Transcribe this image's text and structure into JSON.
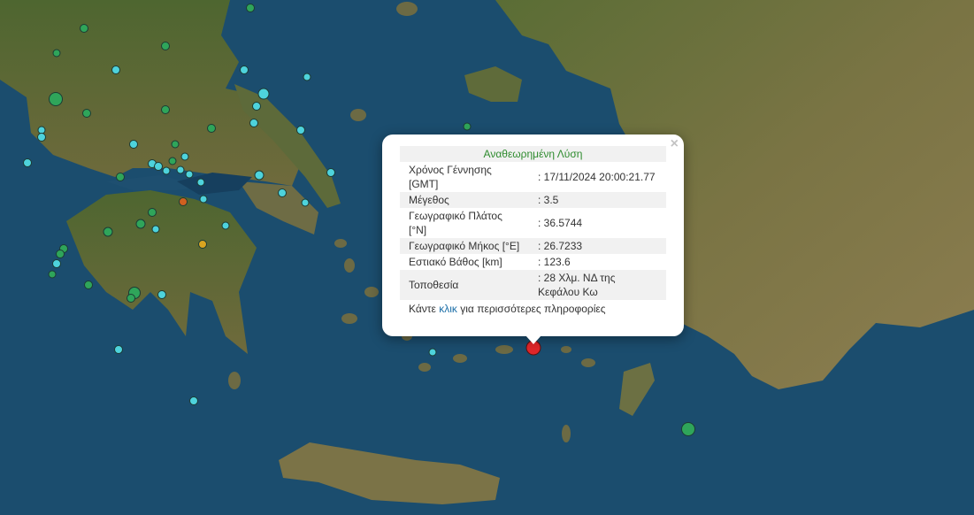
{
  "map": {
    "colors": {
      "sea": "#1b4d6e",
      "land_green": "#4f6a33",
      "land_brown": "#8a7a4c",
      "marker_green": "#2fa55a",
      "marker_cyan": "#4ed3dc",
      "marker_orange": "#d0601f",
      "marker_yellow": "#d9a520",
      "marker_red": "#e0262a"
    }
  },
  "popup": {
    "title": "Αναθεωρημένη Λύση",
    "close": "×",
    "rows": [
      {
        "label": "Χρόνος Γέννησης [GMT]",
        "value": ": 17/11/2024 20:00:21.77"
      },
      {
        "label": "Μέγεθος",
        "value": ": 3.5"
      },
      {
        "label": "Γεωγραφικό Πλάτος [°N]",
        "value": ": 36.5744"
      },
      {
        "label": "Γεωγραφικό Μήκος [°E]",
        "value": ": 26.7233"
      },
      {
        "label": "Εστιακό Βάθος [km]",
        "value": ": 123.6"
      },
      {
        "label": "Τοποθεσία",
        "value": ": 28 Χλμ. ΝΔ της Κεφάλου Κω"
      }
    ],
    "more_prefix": "Κάντε",
    "more_link": "κλικ",
    "more_suffix": "για περισσότερες πληροφορίες"
  }
}
